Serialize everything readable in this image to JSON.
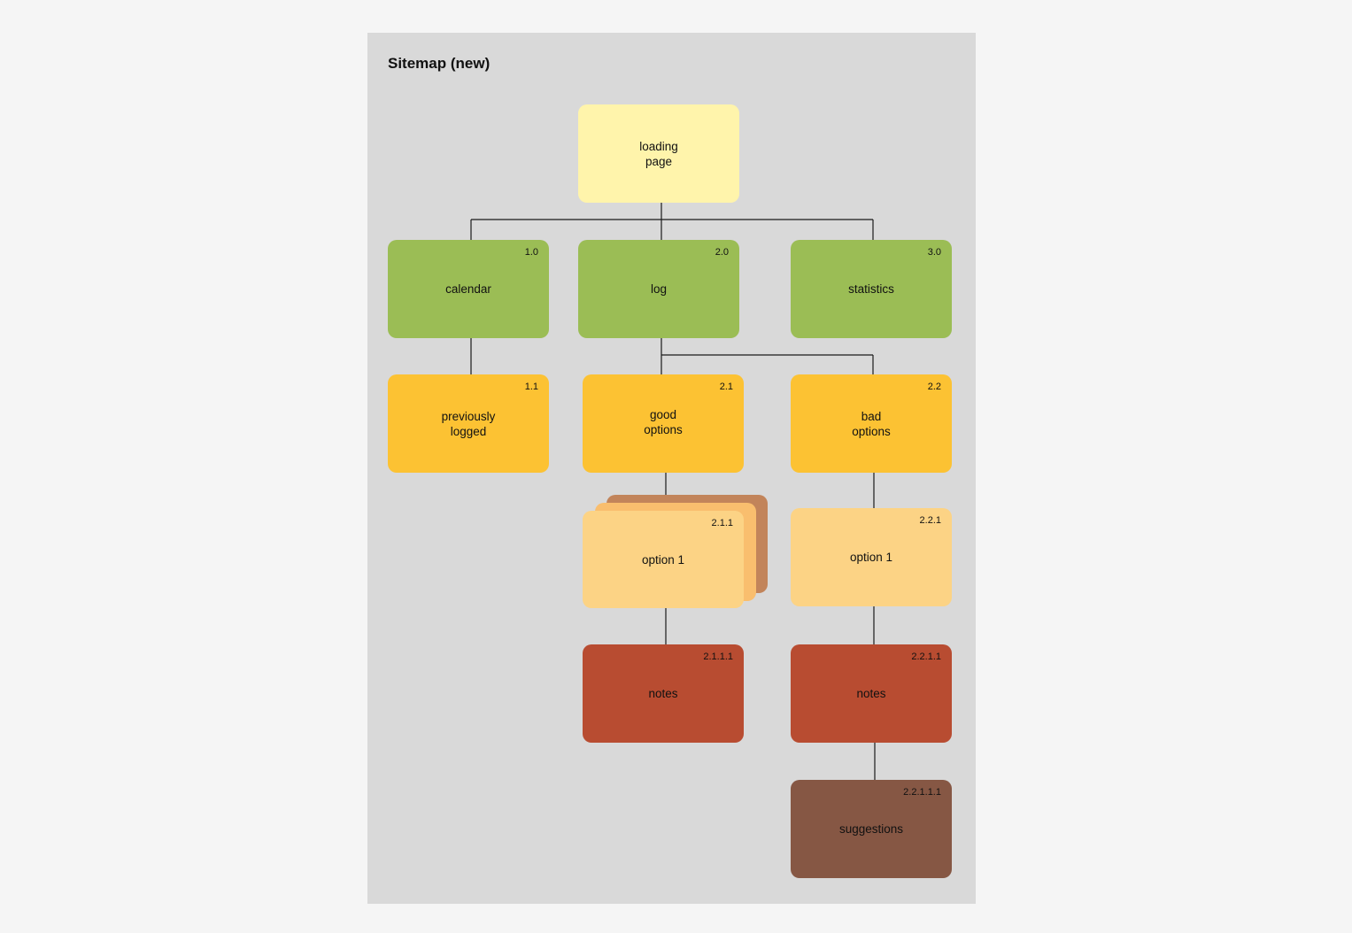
{
  "title": "Sitemap (new)",
  "colors": {
    "frame": "#d9d9d9",
    "root": "#fff4ab",
    "level1": "#9bbd55",
    "level2": "#fcc233",
    "level3": "#fcd385",
    "level4": "#b84c31",
    "level5": "#865744",
    "stack_back": "#c2845a",
    "stack_mid": "#f9be6e"
  },
  "nodes": {
    "loading": {
      "label": "loading\npage",
      "num": ""
    },
    "calendar": {
      "label": "calendar",
      "num": "1.0"
    },
    "log": {
      "label": "log",
      "num": "2.0"
    },
    "statistics": {
      "label": "statistics",
      "num": "3.0"
    },
    "previously_logged": {
      "label": "previously\nlogged",
      "num": "1.1"
    },
    "good_options": {
      "label": "good\noptions",
      "num": "2.1"
    },
    "bad_options": {
      "label": "bad\noptions",
      "num": "2.2"
    },
    "good_option1": {
      "label": "option 1",
      "num": "2.1.1"
    },
    "bad_option1": {
      "label": "option 1",
      "num": "2.2.1"
    },
    "good_notes": {
      "label": "notes",
      "num": "2.1.1.1"
    },
    "bad_notes": {
      "label": "notes",
      "num": "2.2.1.1"
    },
    "suggestions": {
      "label": "suggestions",
      "num": "2.2.1.1.1"
    }
  }
}
